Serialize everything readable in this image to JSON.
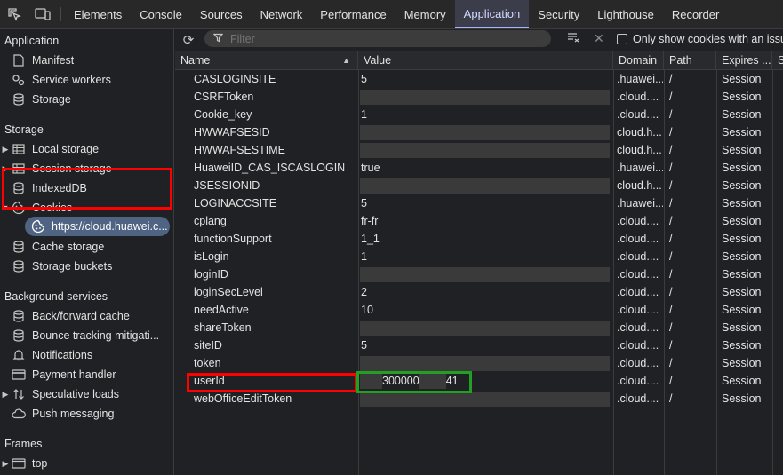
{
  "tabs": [
    "Elements",
    "Console",
    "Sources",
    "Network",
    "Performance",
    "Memory",
    "Application",
    "Security",
    "Lighthouse",
    "Recorder"
  ],
  "active_tab": "Application",
  "sidebar": {
    "application_title": "Application",
    "application_items": [
      "Manifest",
      "Service workers",
      "Storage"
    ],
    "storage_title": "Storage",
    "storage_items": {
      "local_storage": "Local storage",
      "session_storage": "Session storage",
      "indexeddb": "IndexedDB",
      "cookies": "Cookies",
      "cookie_origin": "https://cloud.huawei.c...",
      "cache_storage": "Cache storage",
      "storage_buckets": "Storage buckets"
    },
    "background_title": "Background services",
    "background_items": [
      "Back/forward cache",
      "Bounce tracking mitigati...",
      "Notifications",
      "Payment handler",
      "Speculative loads",
      "Push messaging"
    ],
    "frames_title": "Frames",
    "frames_top": "top"
  },
  "toolbar": {
    "filter_placeholder": "Filter",
    "only_issue_label": "Only show cookies with an issue"
  },
  "table": {
    "columns": [
      "Name",
      "Value",
      "Domain",
      "Path",
      "Expires ...",
      "Si"
    ],
    "rows": [
      {
        "name": "CASLOGINSITE",
        "value": "5",
        "domain": ".huawei...",
        "path": "/",
        "expires": "Session"
      },
      {
        "name": "CSRFToken",
        "value": "",
        "domain": ".cloud....",
        "path": "/",
        "expires": "Session"
      },
      {
        "name": "Cookie_key",
        "value": "1",
        "domain": ".cloud....",
        "path": "/",
        "expires": "Session"
      },
      {
        "name": "HWWAFSESID",
        "value": "",
        "domain": "cloud.h...",
        "path": "/",
        "expires": "Session"
      },
      {
        "name": "HWWAFSESTIME",
        "value": "",
        "domain": "cloud.h...",
        "path": "/",
        "expires": "Session"
      },
      {
        "name": "HuaweiID_CAS_ISCASLOGIN",
        "value": "true",
        "domain": ".huawei...",
        "path": "/",
        "expires": "Session"
      },
      {
        "name": "JSESSIONID",
        "value": "",
        "domain": "cloud.h...",
        "path": "/",
        "expires": "Session"
      },
      {
        "name": "LOGINACCSITE",
        "value": "5",
        "domain": ".huawei...",
        "path": "/",
        "expires": "Session"
      },
      {
        "name": "cplang",
        "value": "fr-fr",
        "domain": ".cloud....",
        "path": "/",
        "expires": "Session"
      },
      {
        "name": "functionSupport",
        "value": "1_1",
        "domain": ".cloud....",
        "path": "/",
        "expires": "Session"
      },
      {
        "name": "isLogin",
        "value": "1",
        "domain": ".cloud....",
        "path": "/",
        "expires": "Session"
      },
      {
        "name": "loginID",
        "value": "",
        "domain": ".cloud....",
        "path": "/",
        "expires": "Session"
      },
      {
        "name": "loginSecLevel",
        "value": "2",
        "domain": ".cloud....",
        "path": "/",
        "expires": "Session"
      },
      {
        "name": "needActive",
        "value": "10",
        "domain": ".cloud....",
        "path": "/",
        "expires": "Session"
      },
      {
        "name": "shareToken",
        "value": "",
        "domain": ".cloud....",
        "path": "/",
        "expires": "Session"
      },
      {
        "name": "siteID",
        "value": "5",
        "domain": ".cloud....",
        "path": "/",
        "expires": "Session"
      },
      {
        "name": "token",
        "value": "",
        "domain": ".cloud....",
        "path": "/",
        "expires": "Session"
      },
      {
        "name": "userId",
        "value_parts": [
          "300000",
          "41"
        ],
        "domain": ".cloud....",
        "path": "/",
        "expires": "Session"
      },
      {
        "name": "webOfficeEditToken",
        "value": "",
        "domain": ".cloud....",
        "path": "/",
        "expires": "Session"
      }
    ]
  },
  "colors": {
    "accent": "#a8b2ff",
    "highlight_red": "#ff0000",
    "highlight_green": "#22a022"
  }
}
